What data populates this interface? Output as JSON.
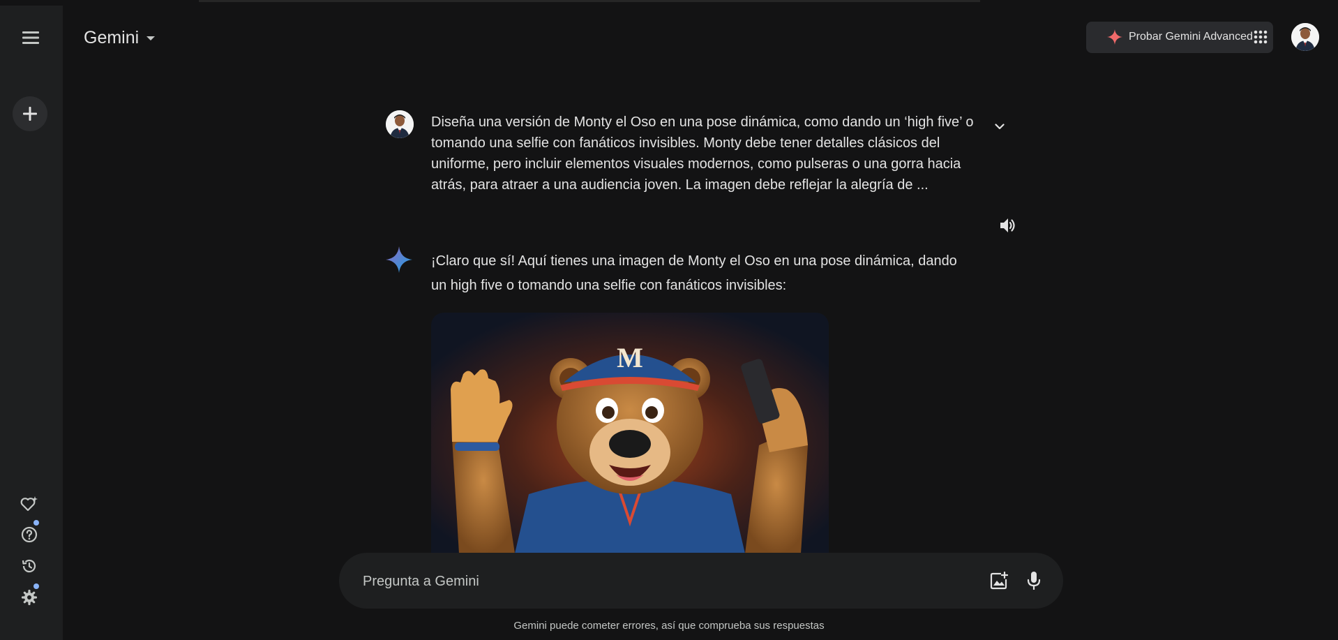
{
  "header": {
    "brand": "Gemini",
    "upgrade_label": "Probar Gemini Advanced"
  },
  "sidebar": {
    "icons": [
      "menu-icon",
      "plus-icon",
      "gem-heart-icon",
      "help-icon",
      "history-icon",
      "gear-icon"
    ]
  },
  "conversation": {
    "user_prompt": "Diseña una versión de Monty el Oso en una pose dinámica, como dando un ‘high five’ o tomando una selfie con fanáticos invisibles. Monty debe tener detalles clásicos del uniforme, pero incluir elementos visuales modernos, como pulseras o una gorra hacia atrás, para atraer a una audiencia joven. La imagen debe reflejar la alegría de ...",
    "response_text": "¡Claro que sí! Aquí tienes una imagen de Monty el Oso en una pose dinámica, dando un high five o tomando una selfie con fanáticos invisibles:",
    "image_cap_letter": "M"
  },
  "input": {
    "placeholder": "Pregunta a Gemini"
  },
  "footer": {
    "disclaimer": "Gemini puede cometer errores, así que comprueba sus respuestas"
  },
  "colors": {
    "background": "#131314",
    "sidebar": "#1e1f20",
    "text": "#e3e3e3",
    "accent_blue": "#8ab4f8",
    "upgrade_star": "#f06a6a"
  }
}
